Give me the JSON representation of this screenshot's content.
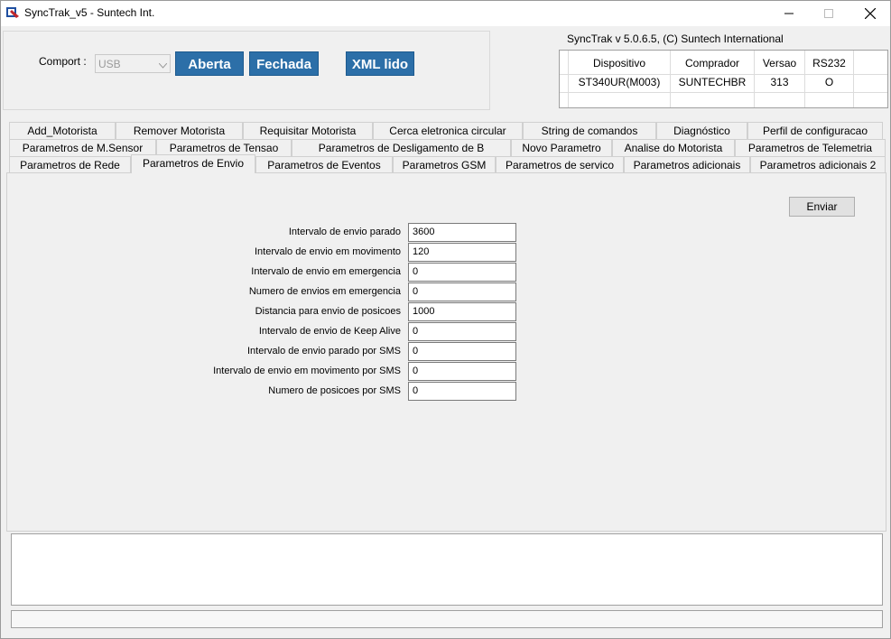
{
  "window": {
    "title": "SyncTrak_v5 - Suntech Int.",
    "icon": "app-logo-icon",
    "controls": [
      "minimize-icon",
      "maximize-icon",
      "close-icon"
    ]
  },
  "connection": {
    "comport_label": "Comport :",
    "comport_value": "USB",
    "btn_open": "Aberta",
    "btn_close": "Fechada",
    "btn_xml": "XML lido",
    "accent": "#2c6fa8"
  },
  "version": "SyncTrak v 5.0.6.5, (C) Suntech International",
  "device_table": {
    "headers": [
      "Dispositivo",
      "Comprador",
      "Versao",
      "RS232"
    ],
    "row": [
      "ST340UR(M003)",
      "SUNTECHBR",
      "313",
      "O"
    ]
  },
  "tabs": {
    "row1": [
      "Add_Motorista",
      "Remover Motorista",
      "Requisitar Motorista",
      "Cerca eletronica circular",
      "String de comandos",
      "Diagnóstico",
      "Perfil de configuracao"
    ],
    "row2": [
      "Parametros  de M.Sensor",
      "Parametros de Tensao",
      "Parametros de Desligamento de B",
      "Novo Parametro",
      "Analise do Motorista",
      "Parametros de Telemetria"
    ],
    "row3": [
      "Parametros de Rede",
      "Parametros de Envio",
      "Parametros de Eventos",
      "Parametros GSM",
      "Parametros de servico",
      "Parametros adicionais",
      "Parametros adicionais 2"
    ],
    "active": "Parametros de Envio"
  },
  "panel": {
    "send_button": "Enviar",
    "fields": [
      {
        "label": "Intervalo de envio parado",
        "value": "3600"
      },
      {
        "label": "Intervalo de envio em movimento",
        "value": "120"
      },
      {
        "label": "Intervalo de envio em emergencia",
        "value": "0"
      },
      {
        "label": "Numero de envios em emergencia",
        "value": "0"
      },
      {
        "label": "Distancia para envio de posicoes",
        "value": "1000"
      },
      {
        "label": "Intervalo de envio de Keep Alive",
        "value": "0"
      },
      {
        "label": "Intervalo de envio parado por SMS",
        "value": "0"
      },
      {
        "label": "Intervalo de envio em movimento por SMS",
        "value": "0"
      },
      {
        "label": "Numero de posicoes por SMS",
        "value": "0"
      }
    ]
  }
}
